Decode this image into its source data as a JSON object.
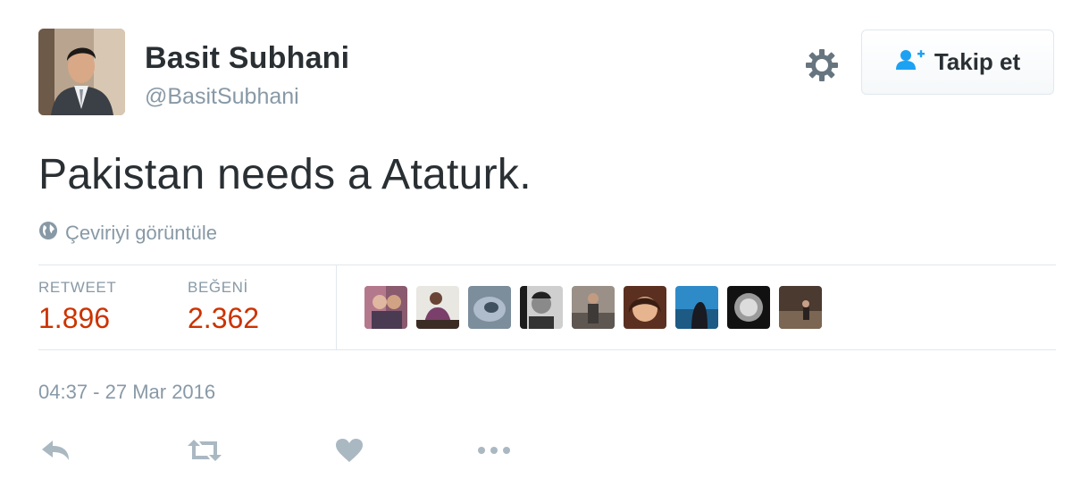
{
  "author": {
    "name": "Basit Subhani",
    "handle": "@BasitSubhani"
  },
  "header": {
    "settings_icon": "gear-icon",
    "follow_label": "Takip et",
    "follow_icon": "add-user-icon",
    "follow_icon_color": "#1da1f2"
  },
  "tweet": {
    "text": "Pakistan needs a Ataturk.",
    "translate_label": "Çeviriyi görüntüle",
    "translate_icon": "globe-icon"
  },
  "stats": {
    "retweets_label": "RETWEET",
    "retweets_value": "1.896",
    "likes_label": "BEĞENİ",
    "likes_value": "2.362",
    "value_color": "#cc3300"
  },
  "likers": [
    {
      "icon": "liker-avatar-1"
    },
    {
      "icon": "liker-avatar-2"
    },
    {
      "icon": "liker-avatar-3"
    },
    {
      "icon": "liker-avatar-4"
    },
    {
      "icon": "liker-avatar-5"
    },
    {
      "icon": "liker-avatar-6"
    },
    {
      "icon": "liker-avatar-7"
    },
    {
      "icon": "liker-avatar-8"
    },
    {
      "icon": "liker-avatar-9"
    }
  ],
  "timestamp": "04:37 - 27 Mar 2016",
  "actions": [
    {
      "icon": "reply-icon"
    },
    {
      "icon": "retweet-icon"
    },
    {
      "icon": "heart-icon"
    },
    {
      "icon": "more-icon"
    }
  ],
  "colors": {
    "text": "#292f33",
    "muted": "#8899a6",
    "border": "#e1e8ed",
    "action_icon": "#aab8c2"
  }
}
